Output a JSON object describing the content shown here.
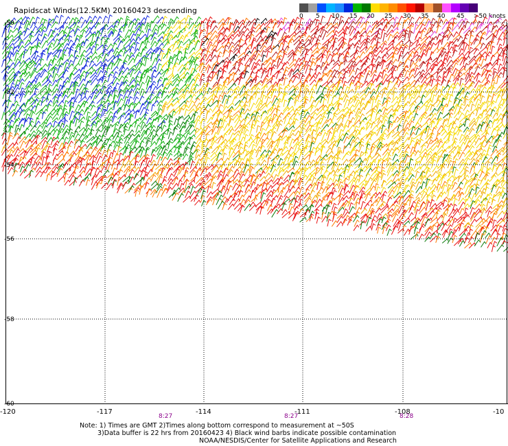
{
  "header": {
    "title": "Rapidscat Winds(12.5KM) 20160423 descending"
  },
  "legend": {
    "colors": [
      "#505050",
      "#a0a0a0",
      "#0050ff",
      "#00b4ff",
      "#1e8cff",
      "#0028dc",
      "#00b400",
      "#007800",
      "#ffdc00",
      "#ffb400",
      "#ff8c00",
      "#ff5000",
      "#ff1400",
      "#b40000",
      "#ffa050",
      "#a05028",
      "#ff50ff",
      "#b400ff",
      "#6400b4",
      "#460078"
    ],
    "labels": [
      "0",
      "5",
      "10",
      "15",
      "20",
      "25",
      "30",
      "35",
      "40",
      "45",
      ">50 knots"
    ]
  },
  "map": {
    "lat_labels": [
      "-50",
      "-52",
      "-54",
      "-56",
      "-58",
      "-60"
    ],
    "lon_labels": [
      "-120",
      "-117",
      "-114",
      "-111",
      "-108",
      "-10"
    ],
    "time_labels": [
      "8:27",
      "8:27",
      "8:28"
    ],
    "barb_colors": {
      "blue": "#1428dc",
      "green": "#10b010",
      "darkgreen": "#0a7a0a",
      "yellow": "#f5d800",
      "gold": "#f0a800",
      "orange": "#ff7800",
      "red": "#e81010",
      "darkred": "#b01414",
      "magenta": "#e040e0",
      "black": "#000000"
    }
  },
  "notes": {
    "line1": "Note: 1) Times are GMT 2)Times along bottom correspond to measurement at ~50S",
    "line2": "3)Data buffer is 22 hrs from 20160423 4) Black wind barbs indicate possible contamination",
    "line3": "NOAA/NESDIS/Center for Satellite Applications and Research"
  }
}
